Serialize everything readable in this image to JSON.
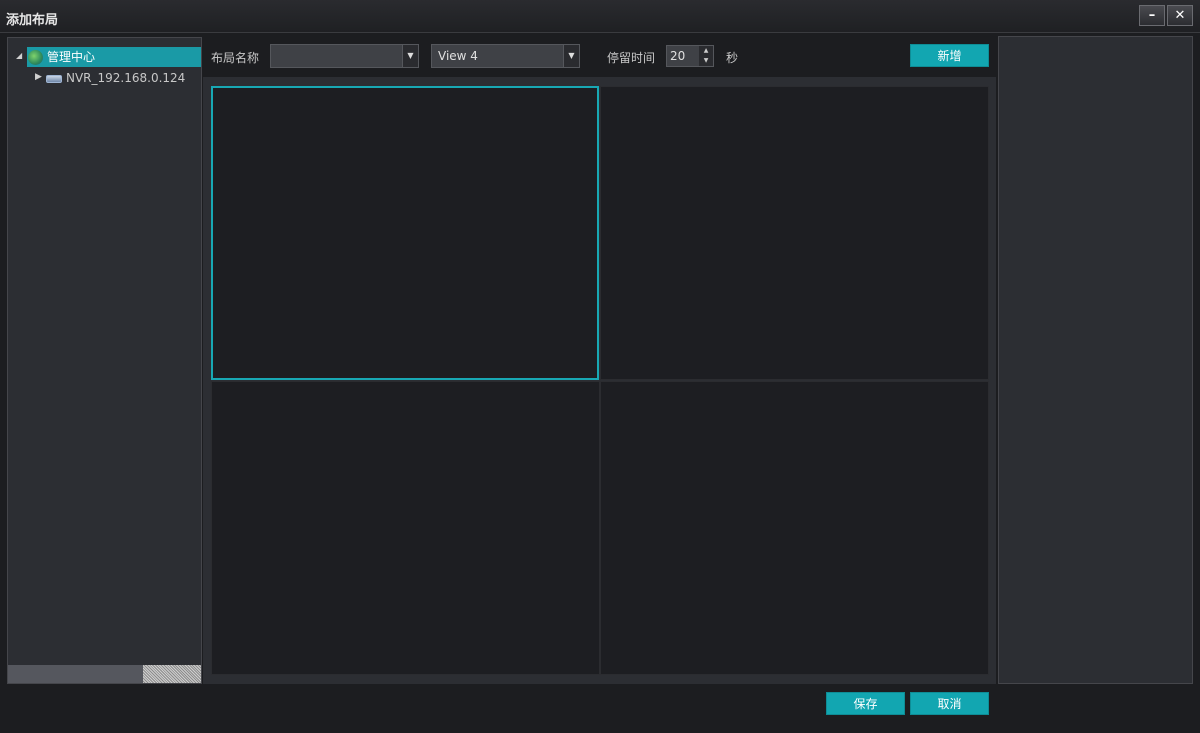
{
  "window": {
    "title": "添加布局",
    "minimize_symbol": "–",
    "close_symbol": "✕"
  },
  "tree": {
    "root_label": "管理中心",
    "child_label": "NVR_192.168.0.124",
    "root_expander": "◢",
    "child_expander": "▶"
  },
  "toolbar": {
    "layout_name_label": "布局名称",
    "layout_name_value": "",
    "view_value": "View 4",
    "dwell_label": "停留时间",
    "dwell_value": "20",
    "dwell_unit": "秒",
    "add_button": "新增",
    "dropdown_arrow": "▼",
    "spin_up": "▲",
    "spin_down": "▼"
  },
  "grid": {
    "cells": 4,
    "selected_cell": 1
  },
  "footer": {
    "save_button": "保存",
    "cancel_button": "取消"
  },
  "colors": {
    "accent": "#12a6b1",
    "selected_border": "#18a8b4"
  }
}
